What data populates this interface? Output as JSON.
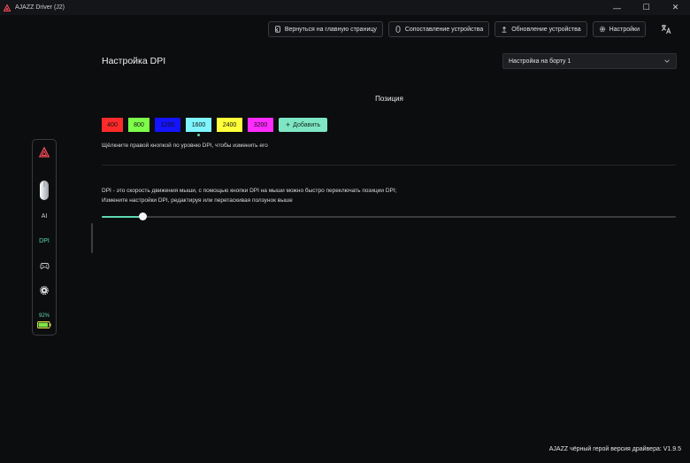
{
  "window": {
    "title": "AJAZZ Driver (J2)",
    "controls": {
      "minimize": "—",
      "maximize": "☐",
      "close": "✕"
    }
  },
  "toolbar": {
    "home_label": "Вернуться на главную страницу",
    "pairing_label": "Сопоставление устройства",
    "update_label": "Обновление устройства",
    "settings_label": "Настройки"
  },
  "page": {
    "title": "Настройка DPI",
    "profile_select": "Настройка на борту 1",
    "section_label": "Позиция",
    "hint": "Щёлкните правой кнопкой по уровню DPI, чтобы изменить его",
    "desc_line1": "DPI - это скорость движения мыши, с помощью кнопки DPI на мыши можно быстро переключать позиции DPI;",
    "desc_line2": "Измените настройки DPI, редактируя или перетаскивая ползунок выше",
    "add_label": "Добавить"
  },
  "dpi_levels": [
    {
      "value": "400",
      "color": "#ff2b2b"
    },
    {
      "value": "800",
      "color": "#7dff4a"
    },
    {
      "value": "1200",
      "color": "#1414ff"
    },
    {
      "value": "1600",
      "color": "#7ff5ff",
      "active": true
    },
    {
      "value": "2400",
      "color": "#ffff3a"
    },
    {
      "value": "3200",
      "color": "#ff2bff"
    }
  ],
  "slider": {
    "fraction": 0.071,
    "accent": "#5dd9b1"
  },
  "sidebar": {
    "ai_label": "AI",
    "dpi_label": "DPI",
    "battery_label": "92%",
    "battery_level": 0.92
  },
  "footer": {
    "version": "AJAZZ чёрный герой версия драйвера: V1.9.5"
  }
}
